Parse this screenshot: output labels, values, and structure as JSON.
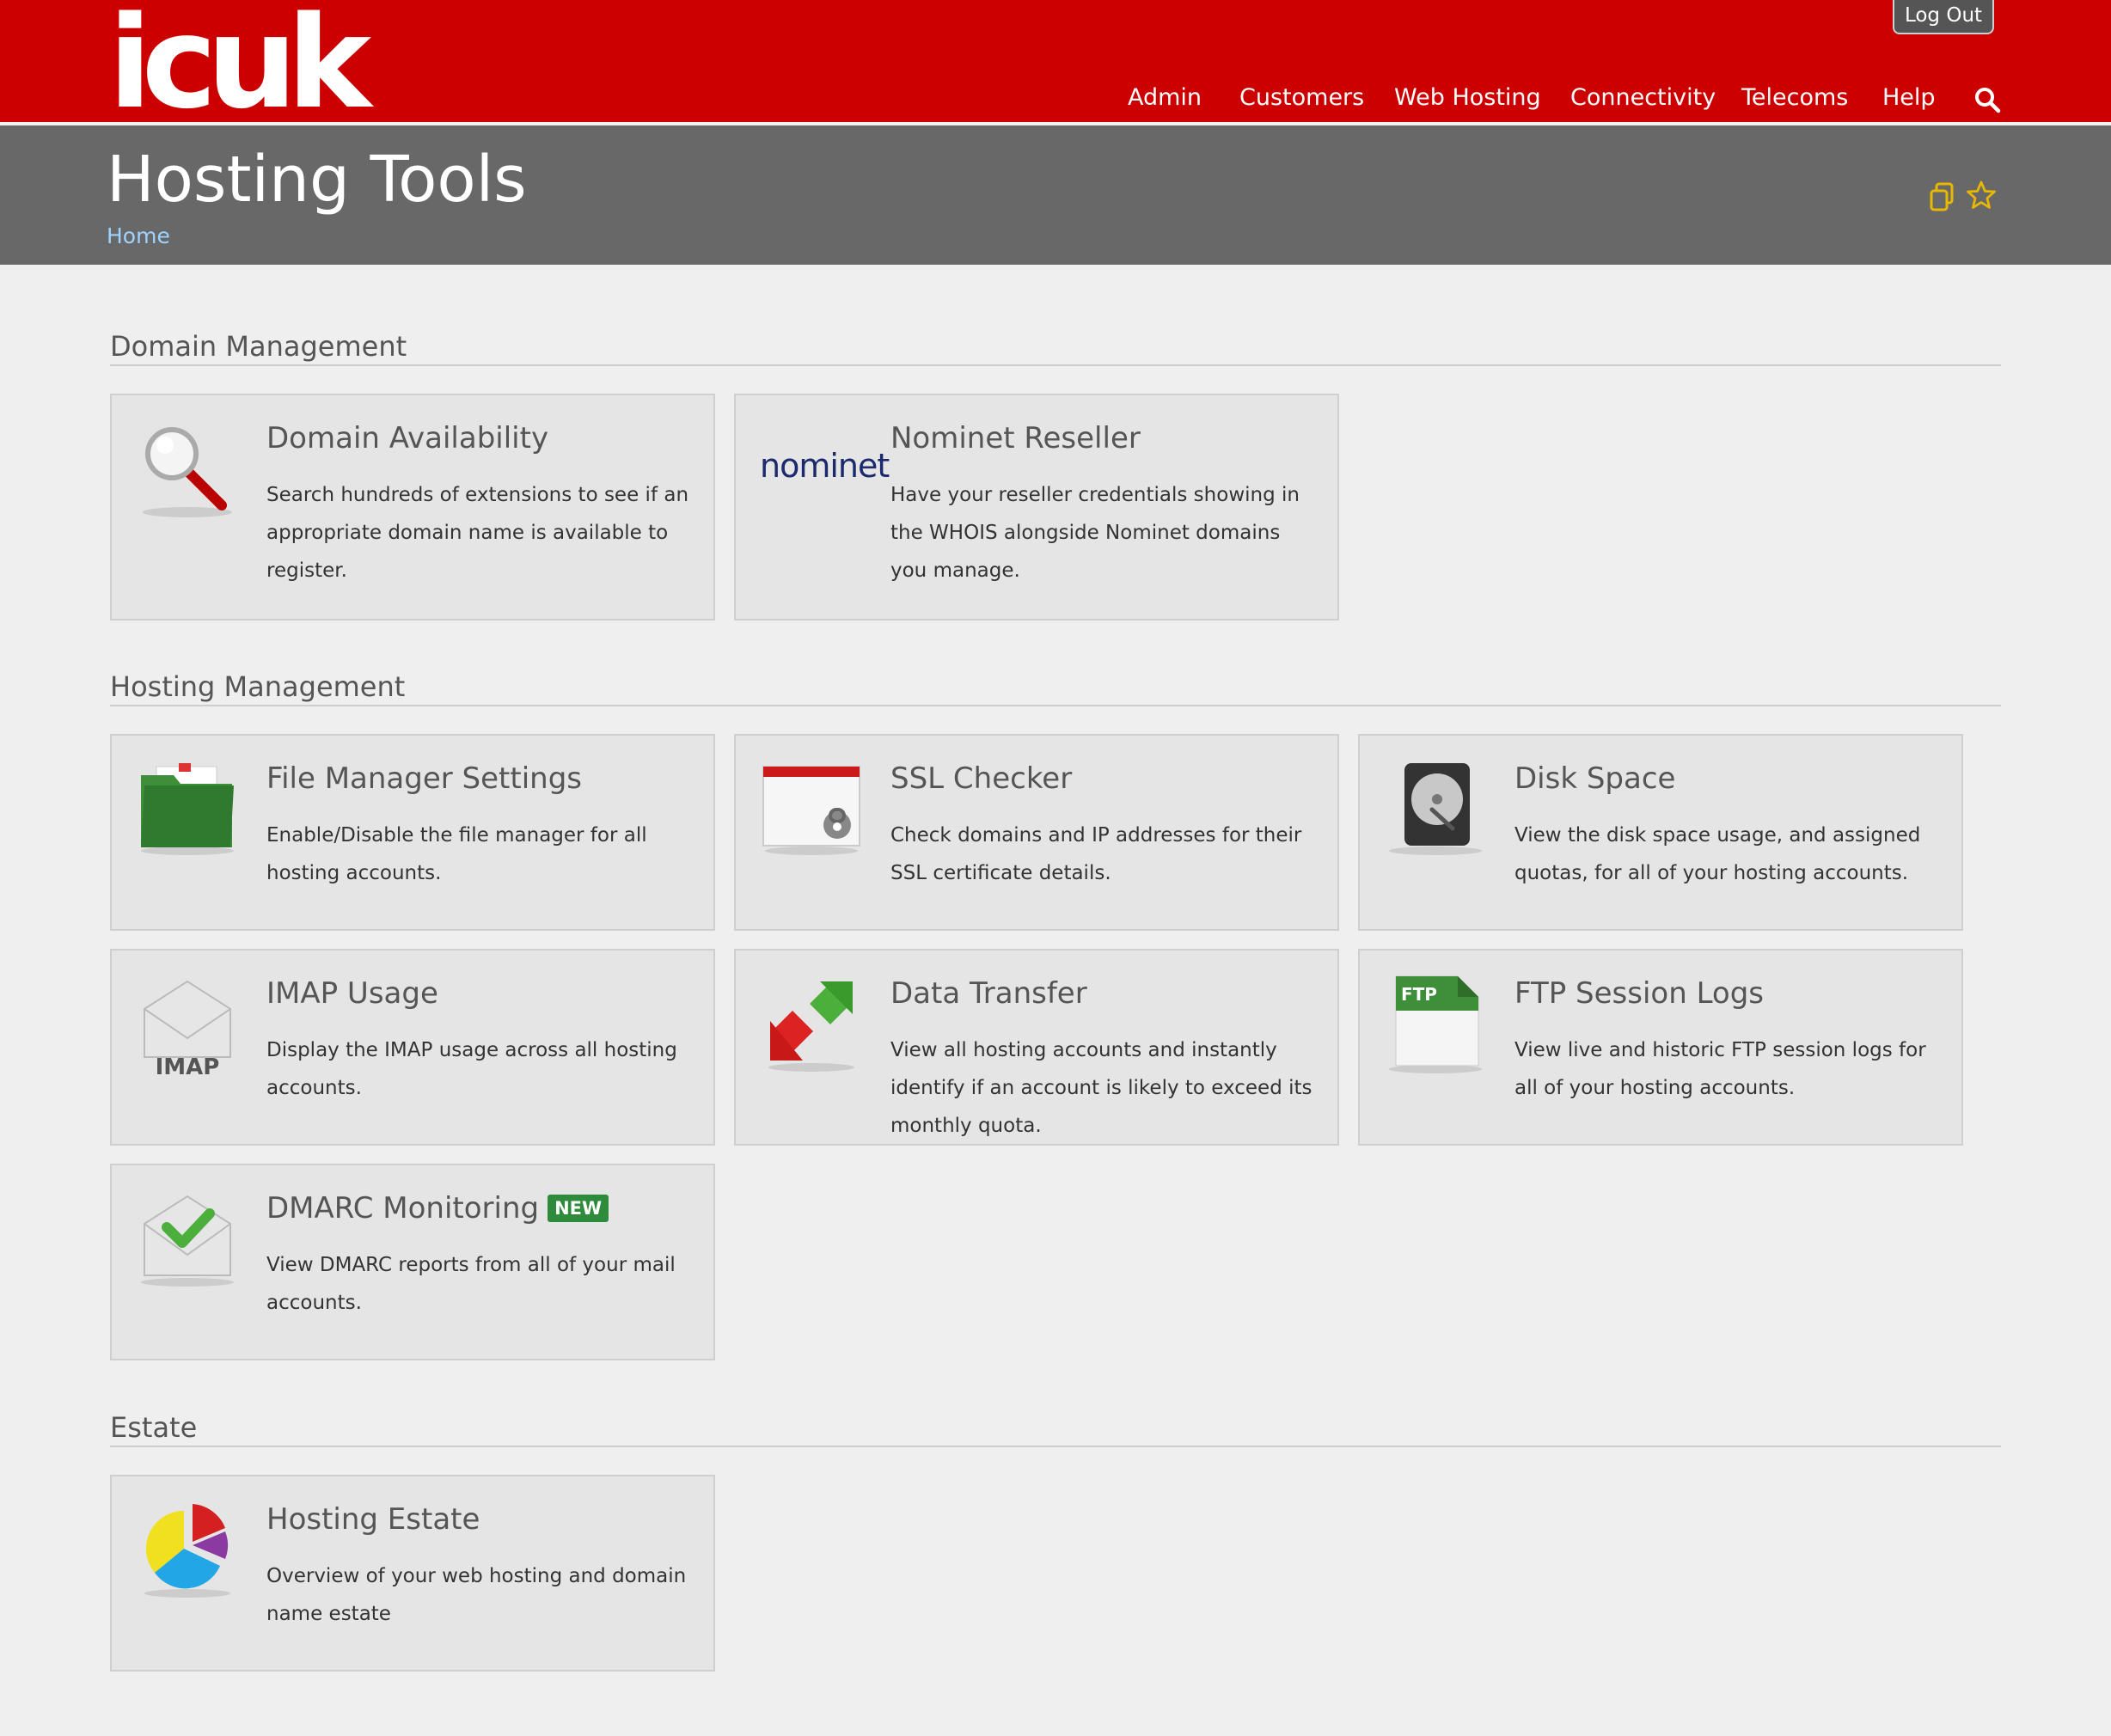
{
  "header": {
    "logo": "icuk",
    "logout_label": "Log Out",
    "nav": [
      "Admin",
      "Customers",
      "Web Hosting",
      "Connectivity",
      "Telecoms",
      "Help"
    ]
  },
  "titlebar": {
    "title": "Hosting Tools",
    "breadcrumb": "Home"
  },
  "sections": {
    "domain": {
      "heading": "Domain Management",
      "cards": [
        {
          "title": "Domain Availability",
          "desc": "Search hundreds of extensions to see if an appropriate domain name is available to register.",
          "icon": "magnifier-icon"
        },
        {
          "title": "Nominet Reseller",
          "desc": "Have your reseller credentials showing in the WHOIS alongside Nominet domains you manage.",
          "icon": "nominet-logo",
          "logo_text": "nominet"
        }
      ]
    },
    "hosting": {
      "heading": "Hosting Management",
      "cards": [
        {
          "title": "File Manager Settings",
          "desc": "Enable/Disable the file manager for all hosting accounts.",
          "icon": "folder-icon"
        },
        {
          "title": "SSL Checker",
          "desc": "Check domains and IP addresses for their SSL certificate details.",
          "icon": "ssl-window-icon"
        },
        {
          "title": "Disk Space",
          "desc": "View the disk space usage, and assigned quotas, for all of your hosting accounts.",
          "icon": "hard-drive-icon"
        },
        {
          "title": "IMAP Usage",
          "desc": "Display the IMAP usage across all hosting accounts.",
          "icon": "imap-envelope-icon",
          "icon_text": "IMAP"
        },
        {
          "title": "Data Transfer",
          "desc": "View all hosting accounts and instantly identify if an account is likely to exceed its monthly quota.",
          "icon": "transfer-arrows-icon"
        },
        {
          "title": "FTP Session Logs",
          "desc": "View live and historic FTP session logs for all of your hosting accounts.",
          "icon": "ftp-document-icon",
          "icon_text": "FTP"
        },
        {
          "title": "DMARC Monitoring",
          "desc": "View DMARC reports from all of your mail accounts.",
          "icon": "dmarc-envelope-check-icon",
          "badge": "NEW"
        }
      ]
    },
    "estate": {
      "heading": "Estate",
      "cards": [
        {
          "title": "Hosting Estate",
          "desc": "Overview of your web hosting and domain name estate",
          "icon": "pie-chart-icon"
        }
      ]
    }
  },
  "colors": {
    "brand_red": "#cc0000",
    "title_bar": "#686868",
    "badge_green": "#2e8b3c",
    "star_yellow": "#e8b800"
  }
}
